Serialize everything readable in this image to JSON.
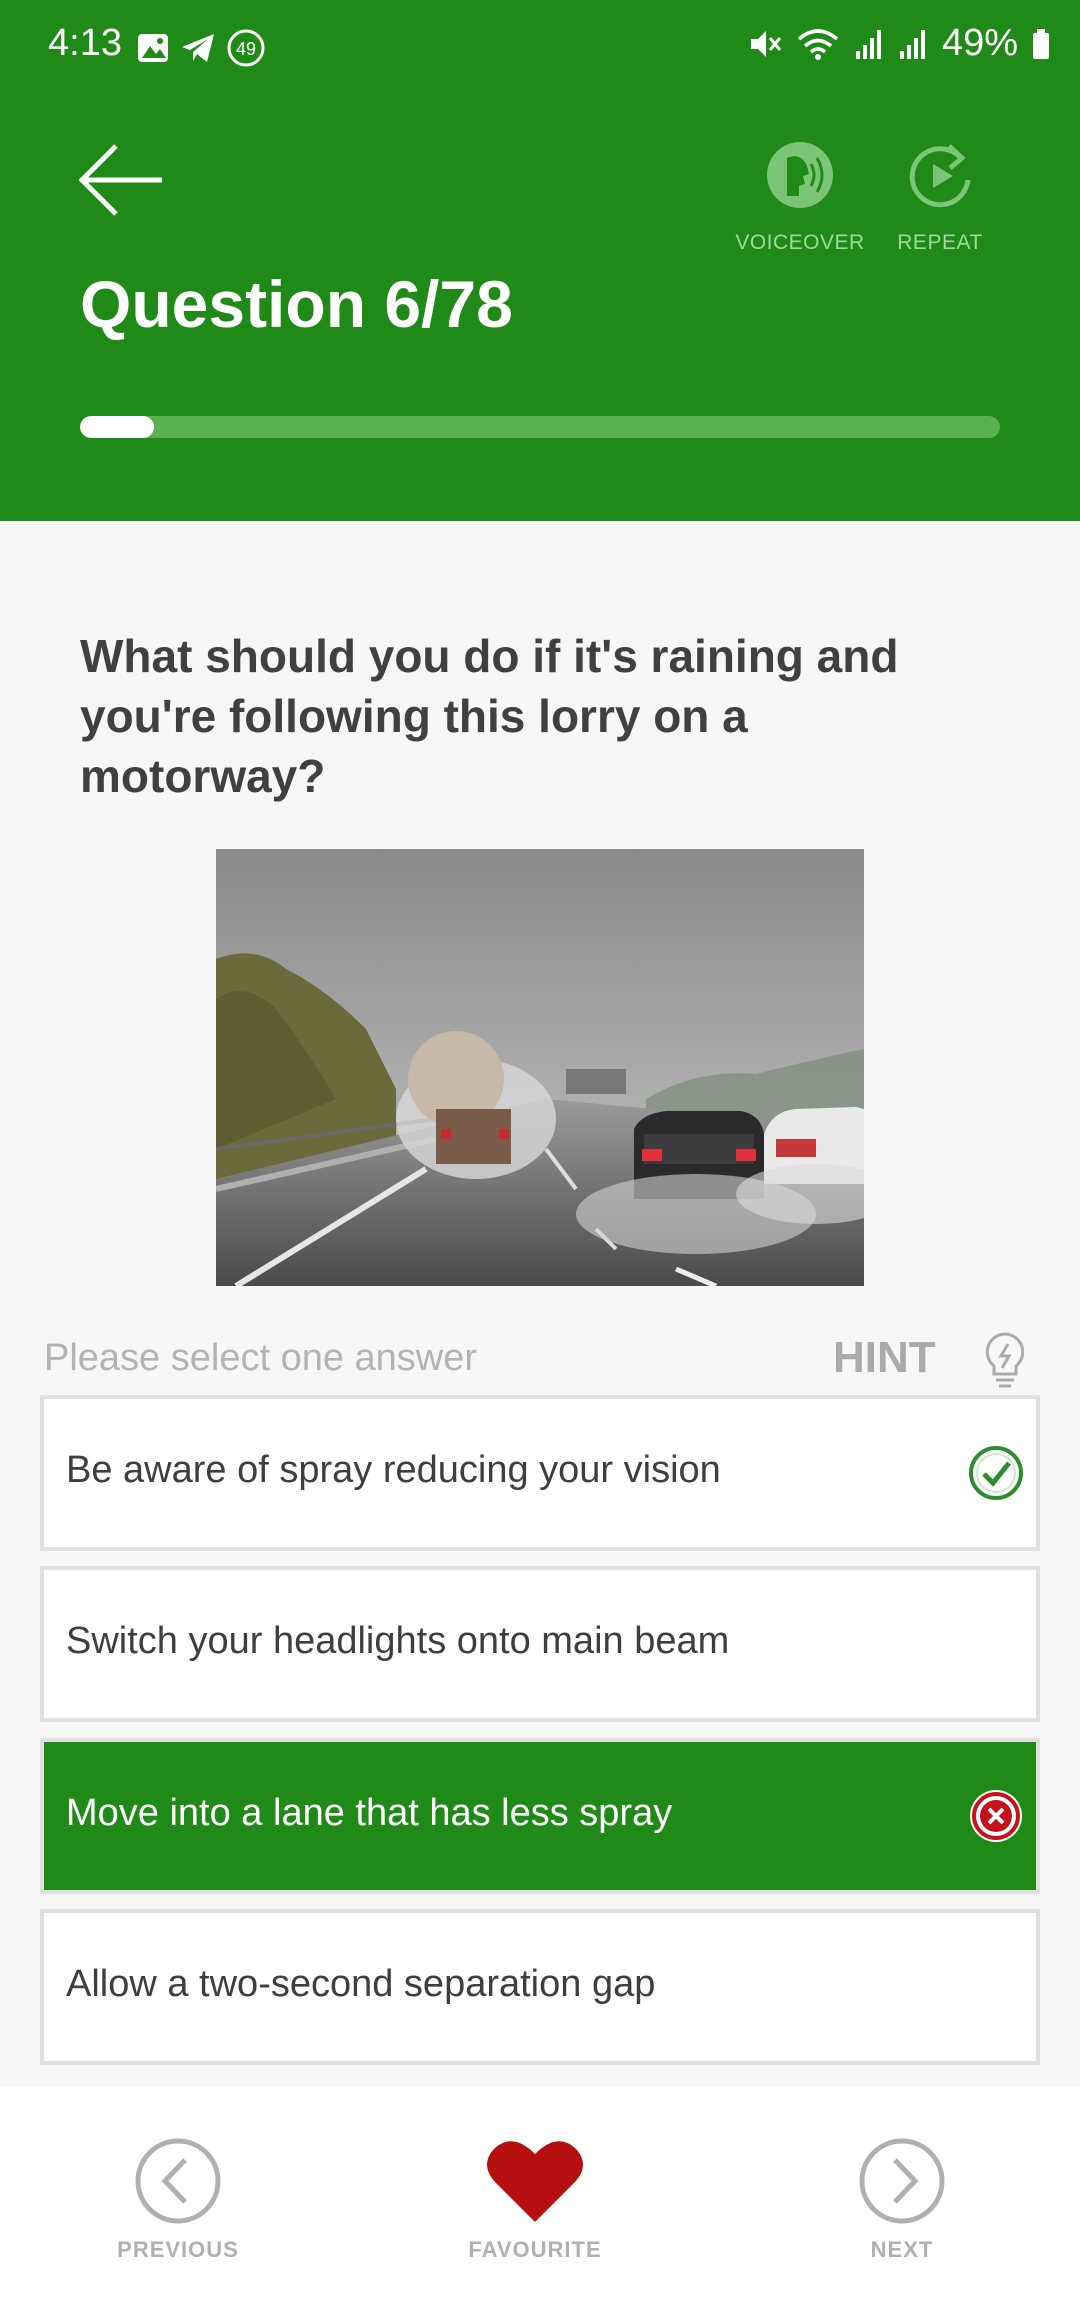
{
  "status": {
    "time": "4:13",
    "notification_count": "49",
    "battery": "49%"
  },
  "header": {
    "title": "Question 6/78",
    "voiceover_label": "VOICEOVER",
    "repeat_label": "REPEAT",
    "progress": 0.08
  },
  "question": {
    "text": "What should you do if it's raining and you're following this lorry on a motorway?"
  },
  "answers": {
    "instruction": "Please select one answer",
    "hint_label": "HINT",
    "items": [
      {
        "label": "Be aware of spray reducing your vision",
        "state": "correct"
      },
      {
        "label": "Switch your headlights onto main beam",
        "state": "none"
      },
      {
        "label": "Move into a lane that has less spray",
        "state": "wrong-selected"
      },
      {
        "label": "Allow a two-second separation gap",
        "state": "none"
      }
    ]
  },
  "nav": {
    "previous": "PREVIOUS",
    "favourite": "FAVOURITE",
    "next": "NEXT"
  },
  "colors": {
    "brand_green": "#1f8a17",
    "correct": "#2e8b2e",
    "wrong": "#c4121d",
    "favourite": "#b50f0f"
  }
}
